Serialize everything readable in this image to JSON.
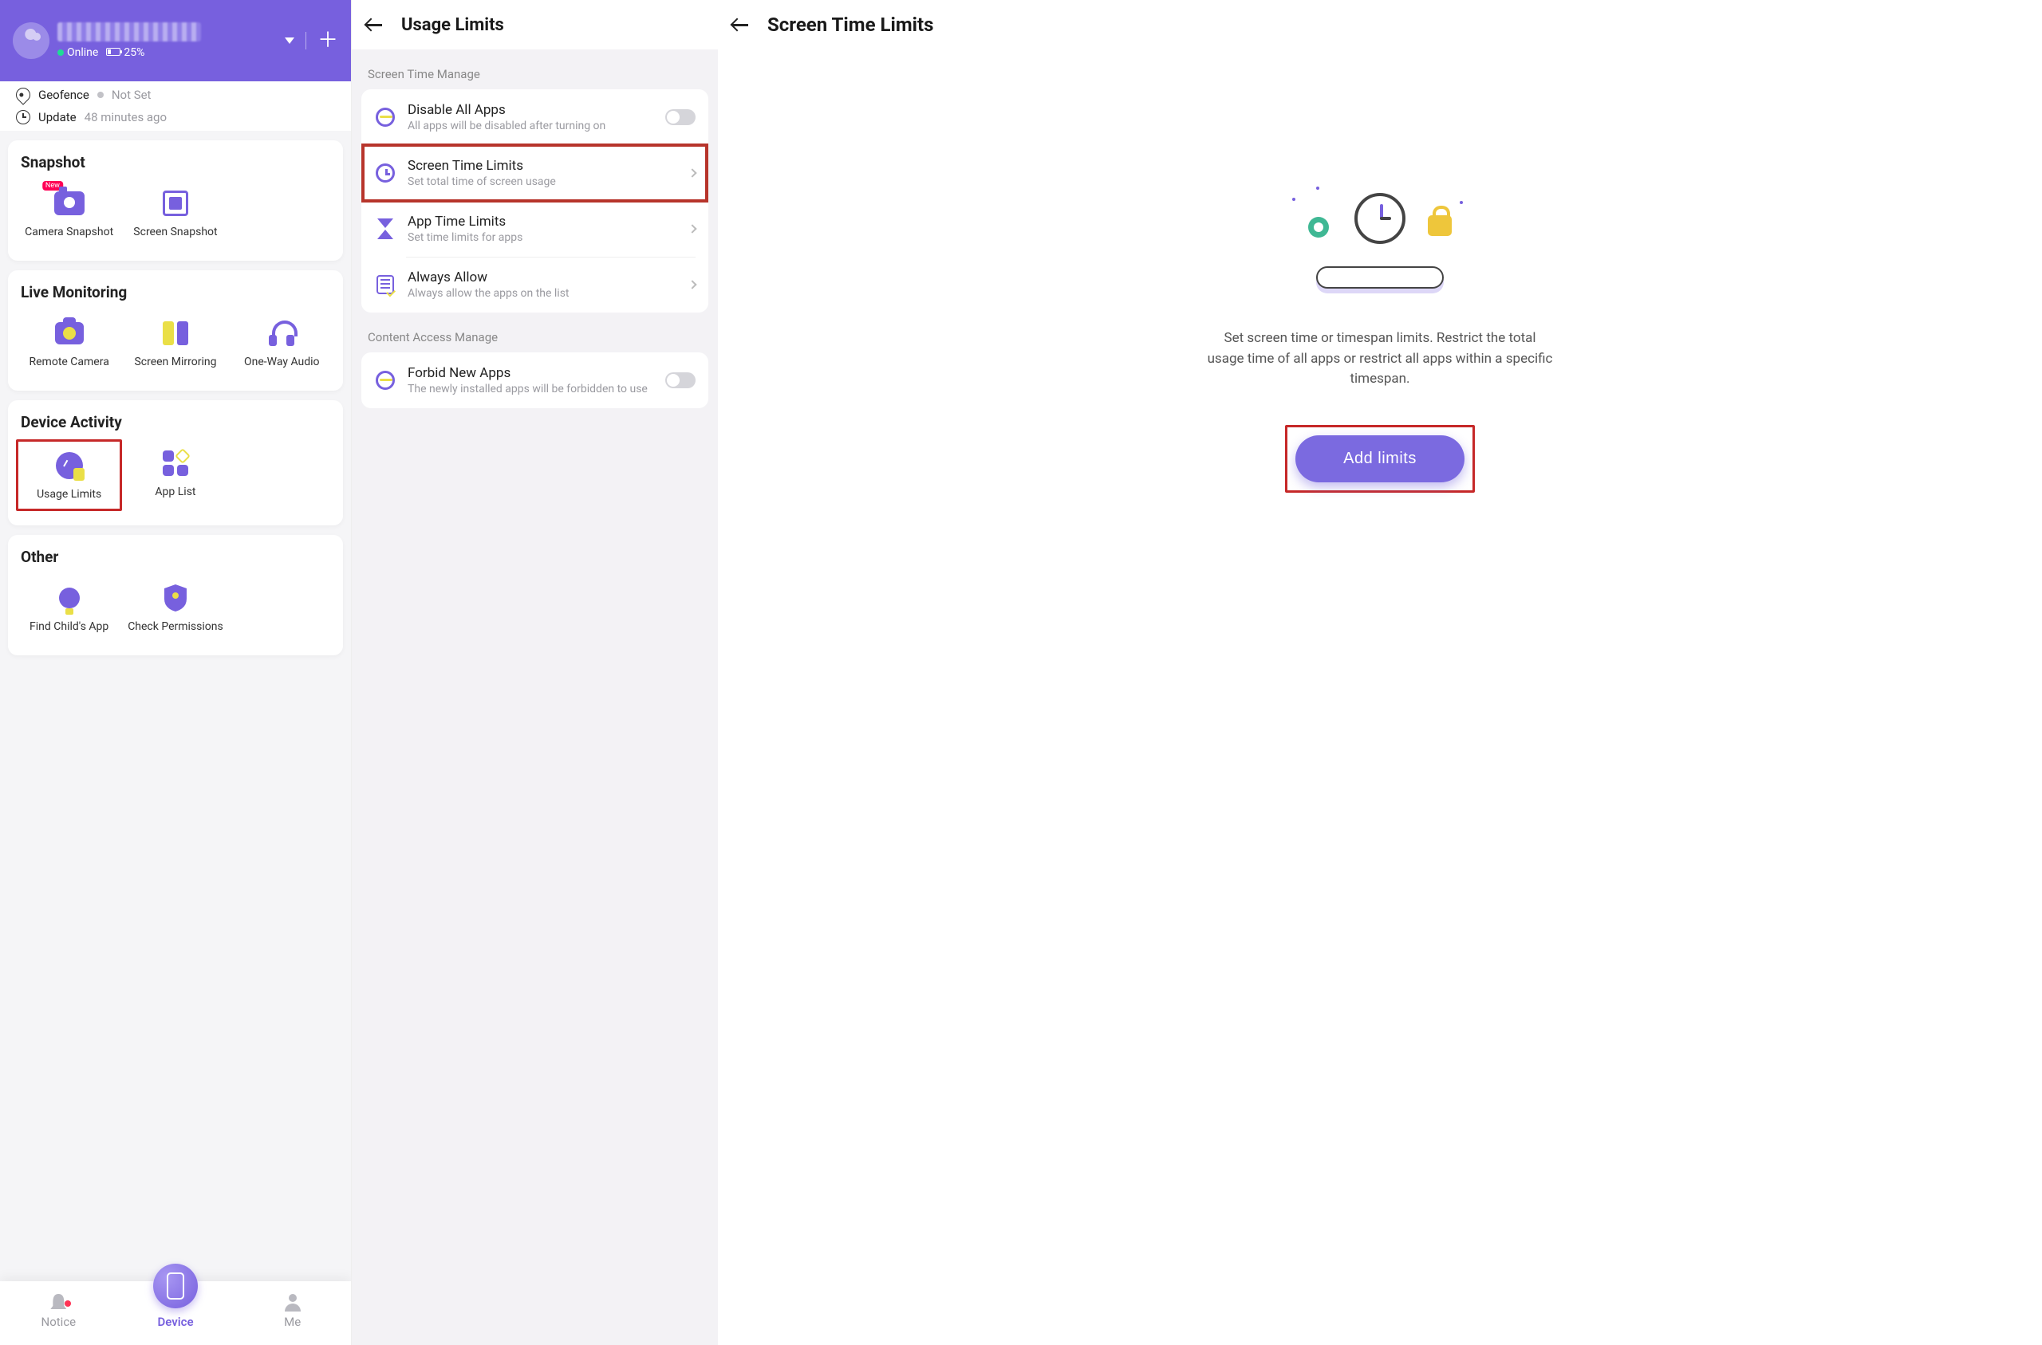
{
  "pane1": {
    "status": {
      "online": "Online",
      "battery_pct": "25%"
    },
    "geofence": {
      "label": "Geofence",
      "value": "Not Set"
    },
    "update": {
      "label": "Update",
      "value": "48 minutes ago"
    },
    "sections": {
      "snapshot": {
        "title": "Snapshot",
        "camera_snapshot": "Camera Snapshot",
        "screen_snapshot": "Screen Snapshot",
        "new_badge": "New"
      },
      "live": {
        "title": "Live Monitoring",
        "remote_camera": "Remote Camera",
        "screen_mirroring": "Screen Mirroring",
        "one_way_audio": "One-Way Audio"
      },
      "device": {
        "title": "Device Activity",
        "usage_limits": "Usage Limits",
        "app_list": "App List"
      },
      "other": {
        "title": "Other",
        "find_child": "Find Child's App",
        "check_permissions": "Check Permissions"
      }
    },
    "nav": {
      "notice": "Notice",
      "device": "Device",
      "me": "Me"
    }
  },
  "pane2": {
    "title": "Usage Limits",
    "section_screen": "Screen Time Manage",
    "disable_all": {
      "title": "Disable All Apps",
      "sub": "All apps will be disabled after turning on"
    },
    "screen_time": {
      "title": "Screen Time Limits",
      "sub": "Set total time of screen usage"
    },
    "app_time": {
      "title": "App Time Limits",
      "sub": "Set time limits for apps"
    },
    "always_allow": {
      "title": "Always Allow",
      "sub": "Always allow the apps on the list"
    },
    "section_content": "Content Access Manage",
    "forbid_new": {
      "title": "Forbid New Apps",
      "sub": "The newly installed apps will be forbidden to use"
    }
  },
  "pane3": {
    "title": "Screen Time Limits",
    "description": "Set screen time or timespan limits. Restrict the total usage time of all apps or restrict all apps within a specific timespan.",
    "add_limits": "Add limits"
  }
}
